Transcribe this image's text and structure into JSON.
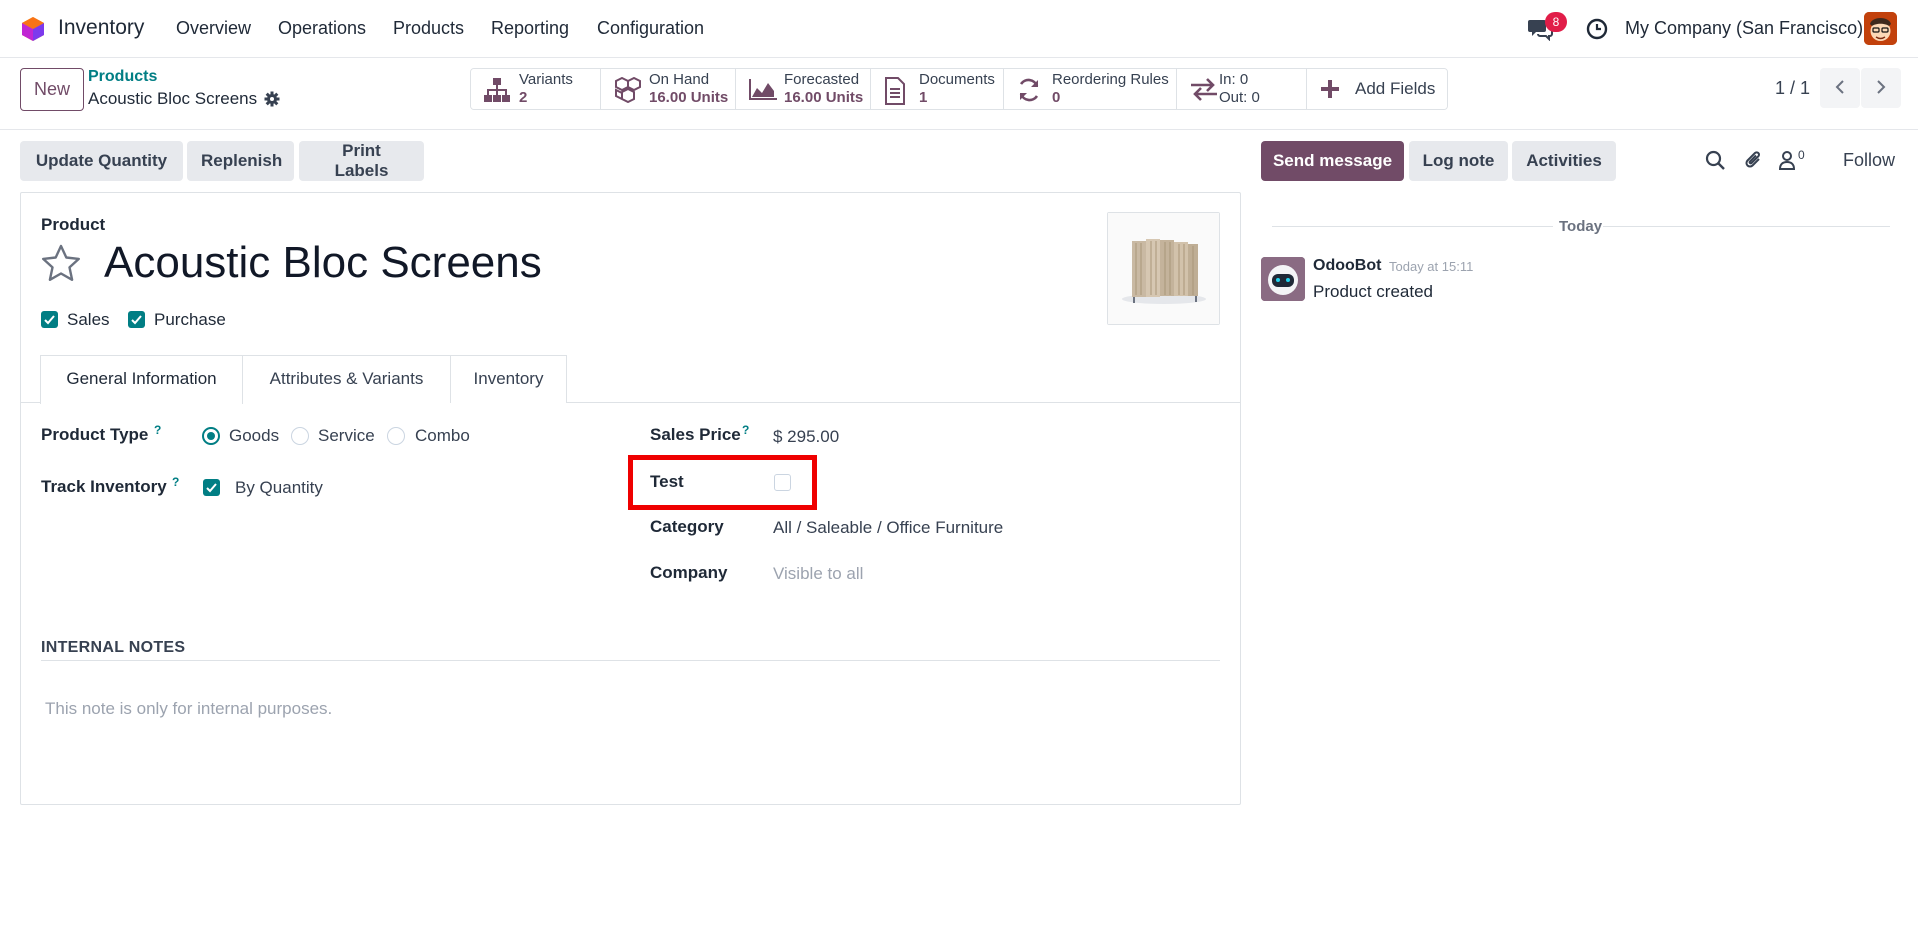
{
  "app": {
    "name": "Inventory",
    "logo": "odoo-hexagon-icon"
  },
  "menu": [
    "Overview",
    "Operations",
    "Products",
    "Reporting",
    "Configuration"
  ],
  "systray": {
    "messages_badge": "8",
    "company": "My Company (San Francisco)"
  },
  "breadcrumb": {
    "parent": "Products",
    "current": "Acoustic Bloc Screens"
  },
  "new_label": "New",
  "smart_buttons": {
    "variants": {
      "label": "Variants",
      "value": "2"
    },
    "on_hand": {
      "label": "On Hand",
      "value": "16.00 Units"
    },
    "forecasted": {
      "label": "Forecasted",
      "value": "16.00 Units"
    },
    "documents": {
      "label": "Documents",
      "value": "1"
    },
    "reordering": {
      "label": "Reordering Rules",
      "value": "0"
    },
    "in_out": {
      "in": "In: 0",
      "out": "Out: 0"
    },
    "add_fields": "Add Fields"
  },
  "pager": "1 / 1",
  "actions": {
    "update_qty": "Update Quantity",
    "replenish": "Replenish",
    "print_labels": "Print Labels"
  },
  "chatter": {
    "send_message": "Send message",
    "log_note": "Log note",
    "activities": "Activities",
    "followers_count": "0",
    "follow": "Follow",
    "date_separator": "Today",
    "message": {
      "author": "OdooBot",
      "time": "Today at 15:11",
      "body": "Product created"
    }
  },
  "form": {
    "product_label": "Product",
    "name": "Acoustic Bloc Screens",
    "sales_label": "Sales",
    "purchase_label": "Purchase",
    "tabs": [
      "General Information",
      "Attributes & Variants",
      "Inventory"
    ],
    "product_type": {
      "label": "Product Type",
      "options": [
        "Goods",
        "Service",
        "Combo"
      ],
      "selected": "Goods"
    },
    "track_inventory": {
      "label": "Track Inventory",
      "value": "By Quantity"
    },
    "sales_price": {
      "label": "Sales Price",
      "value": "$ 295.00"
    },
    "test": {
      "label": "Test",
      "checked": false
    },
    "category": {
      "label": "Category",
      "value": "All / Saleable / Office Furniture"
    },
    "company": {
      "label": "Company",
      "placeholder": "Visible to all"
    },
    "internal_notes": {
      "heading": "INTERNAL NOTES",
      "placeholder": "This note is only for internal purposes."
    },
    "help_marker": "?"
  },
  "colors": {
    "brand": "#714b67",
    "accent": "#017e84",
    "badge": "#e11d48",
    "highlight": "#ef0000"
  }
}
